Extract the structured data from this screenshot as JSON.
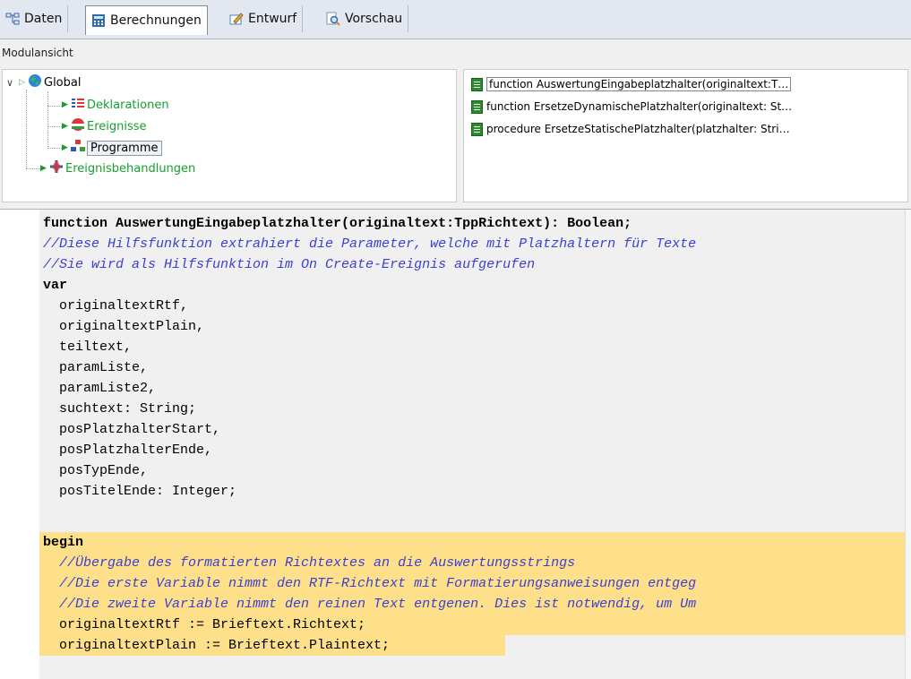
{
  "tabs": [
    {
      "label": "Daten",
      "icon": "data-tree-icon"
    },
    {
      "label": "Berechnungen",
      "icon": "calculator-icon",
      "active": true
    },
    {
      "label": "Entwurf",
      "icon": "design-pencil-icon"
    },
    {
      "label": "Vorschau",
      "icon": "preview-magnifier-icon"
    }
  ],
  "module_view_label": "Modulansicht",
  "tree": {
    "root": "Global",
    "children": [
      "Deklarationen",
      "Ereignisse",
      "Programme"
    ],
    "sibling": "Ereignisbehandlungen"
  },
  "functions": [
    "function AuswertungEingabeplatzhalter(originaltext:T…",
    "function ErsetzeDynamischePlatzhalter(originaltext: St…",
    "procedure ErsetzeStatischePlatzhalter(platzhalter: Stri…"
  ],
  "code_lines": [
    "function AuswertungEingabeplatzhalter(originaltext:TppRichtext): Boolean;",
    "//Diese Hilfsfunktion extrahiert die Parameter, welche mit Platzhaltern für Texte",
    "//Sie wird als Hilfsfunktion im On Create-Ereignis aufgerufen",
    "var",
    "  originaltextRtf,",
    "  originaltextPlain,",
    "  teiltext,",
    "  paramListe,",
    "  paramListe2,",
    "  suchtext: String;",
    "  posPlatzhalterStart,",
    "  posPlatzhalterEnde,",
    "  posTypEnde,",
    "  posTitelEnde: Integer;",
    "begin",
    "  //Übergabe des formatierten Richtextes an die Auswertungsstrings",
    "  //Die erste Variable nimmt den RTF-Richtext mit Formatierungsanweisungen entgeg",
    "  //Die zweite Variable nimmt den reinen Text entgenen. Dies ist notwendig, um Um",
    "  originaltextRtf := Brieftext.Richtext;",
    "  originaltextPlain := Brieftext.Plaintext;"
  ],
  "colors": {
    "highlight": "#ffe08a",
    "comment": "#3b3fd1",
    "tree_green": "#159f2c"
  }
}
